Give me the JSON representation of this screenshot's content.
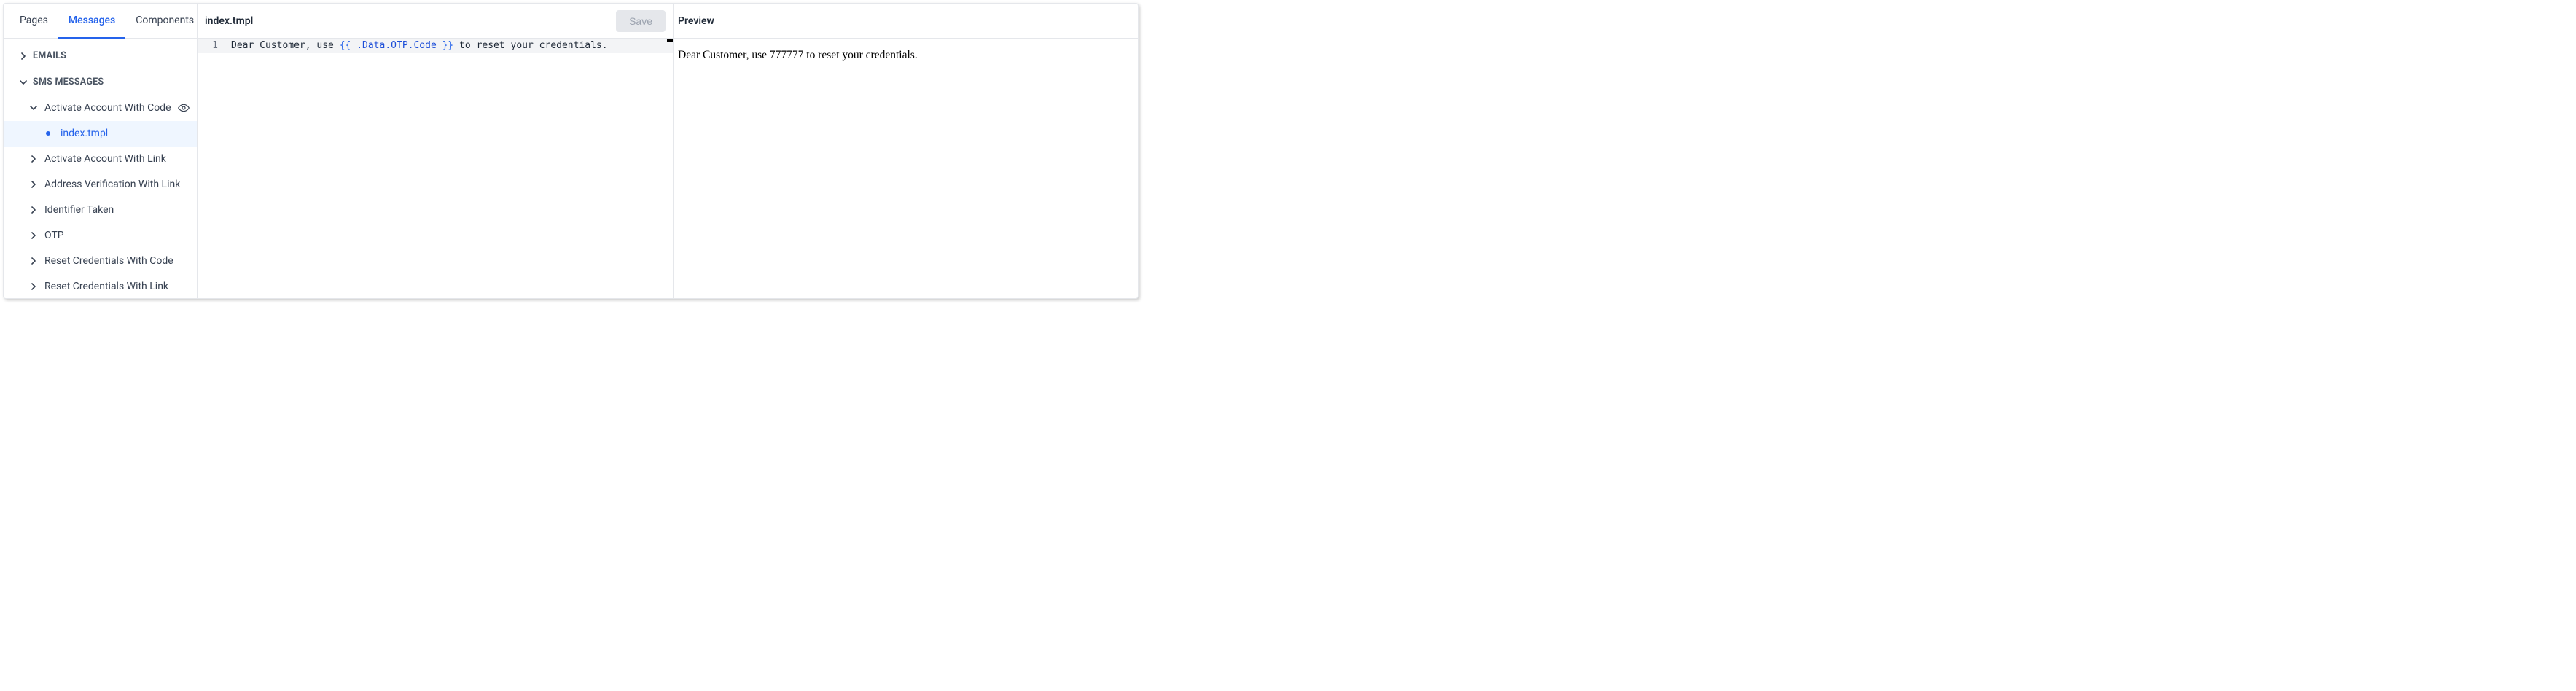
{
  "tabs": {
    "pages": "Pages",
    "messages": "Messages",
    "components": "Components"
  },
  "tree": {
    "emails": {
      "label": "EMAILS"
    },
    "sms": {
      "label": "SMS MESSAGES",
      "items": [
        {
          "label": "Activate Account With Code",
          "expanded": true,
          "eye": true,
          "file": "index.tmpl"
        },
        {
          "label": "Activate Account With Link"
        },
        {
          "label": "Address Verification With Link"
        },
        {
          "label": "Identifier Taken"
        },
        {
          "label": "OTP"
        },
        {
          "label": "Reset Credentials With Code"
        },
        {
          "label": "Reset Credentials With Link"
        }
      ]
    }
  },
  "editor": {
    "title": "index.tmpl",
    "save_label": "Save",
    "line_no": "1",
    "code": {
      "pre": "Dear Customer, use ",
      "open": "{{",
      "expr": " .Data.OTP.Code ",
      "close": "}}",
      "post": " to reset your credentials."
    }
  },
  "preview": {
    "title": "Preview",
    "body": "Dear Customer, use 777777 to reset your credentials."
  }
}
